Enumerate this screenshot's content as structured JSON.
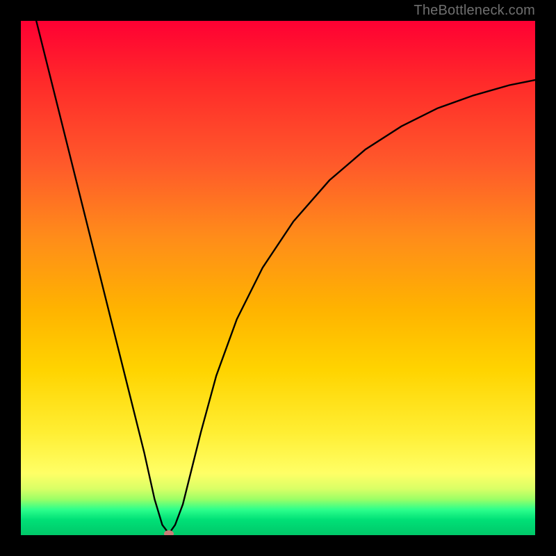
{
  "watermark": "TheBottleneck.com",
  "chart_data": {
    "type": "line",
    "title": "",
    "xlabel": "",
    "ylabel": "",
    "xlim": [
      0,
      100
    ],
    "ylim": [
      0,
      100
    ],
    "grid": false,
    "series": [
      {
        "name": "curve",
        "x": [
          3,
          6,
          9,
          12,
          15,
          18,
          21,
          24,
          26,
          27.5,
          28.8,
          30,
          31.5,
          33,
          35,
          38,
          42,
          47,
          53,
          60,
          67,
          74,
          81,
          88,
          95,
          100
        ],
        "y": [
          100,
          88,
          76,
          64,
          52,
          40,
          28,
          16,
          7,
          2,
          0.3,
          2,
          6,
          12,
          20,
          31,
          42,
          52,
          61,
          69,
          75,
          79.5,
          83,
          85.5,
          87.5,
          88.5
        ]
      }
    ],
    "marker": {
      "x": 28.8,
      "y": 0.3
    },
    "background": "vertical-gradient red→orange→yellow→green",
    "curve_color": "#000000"
  }
}
